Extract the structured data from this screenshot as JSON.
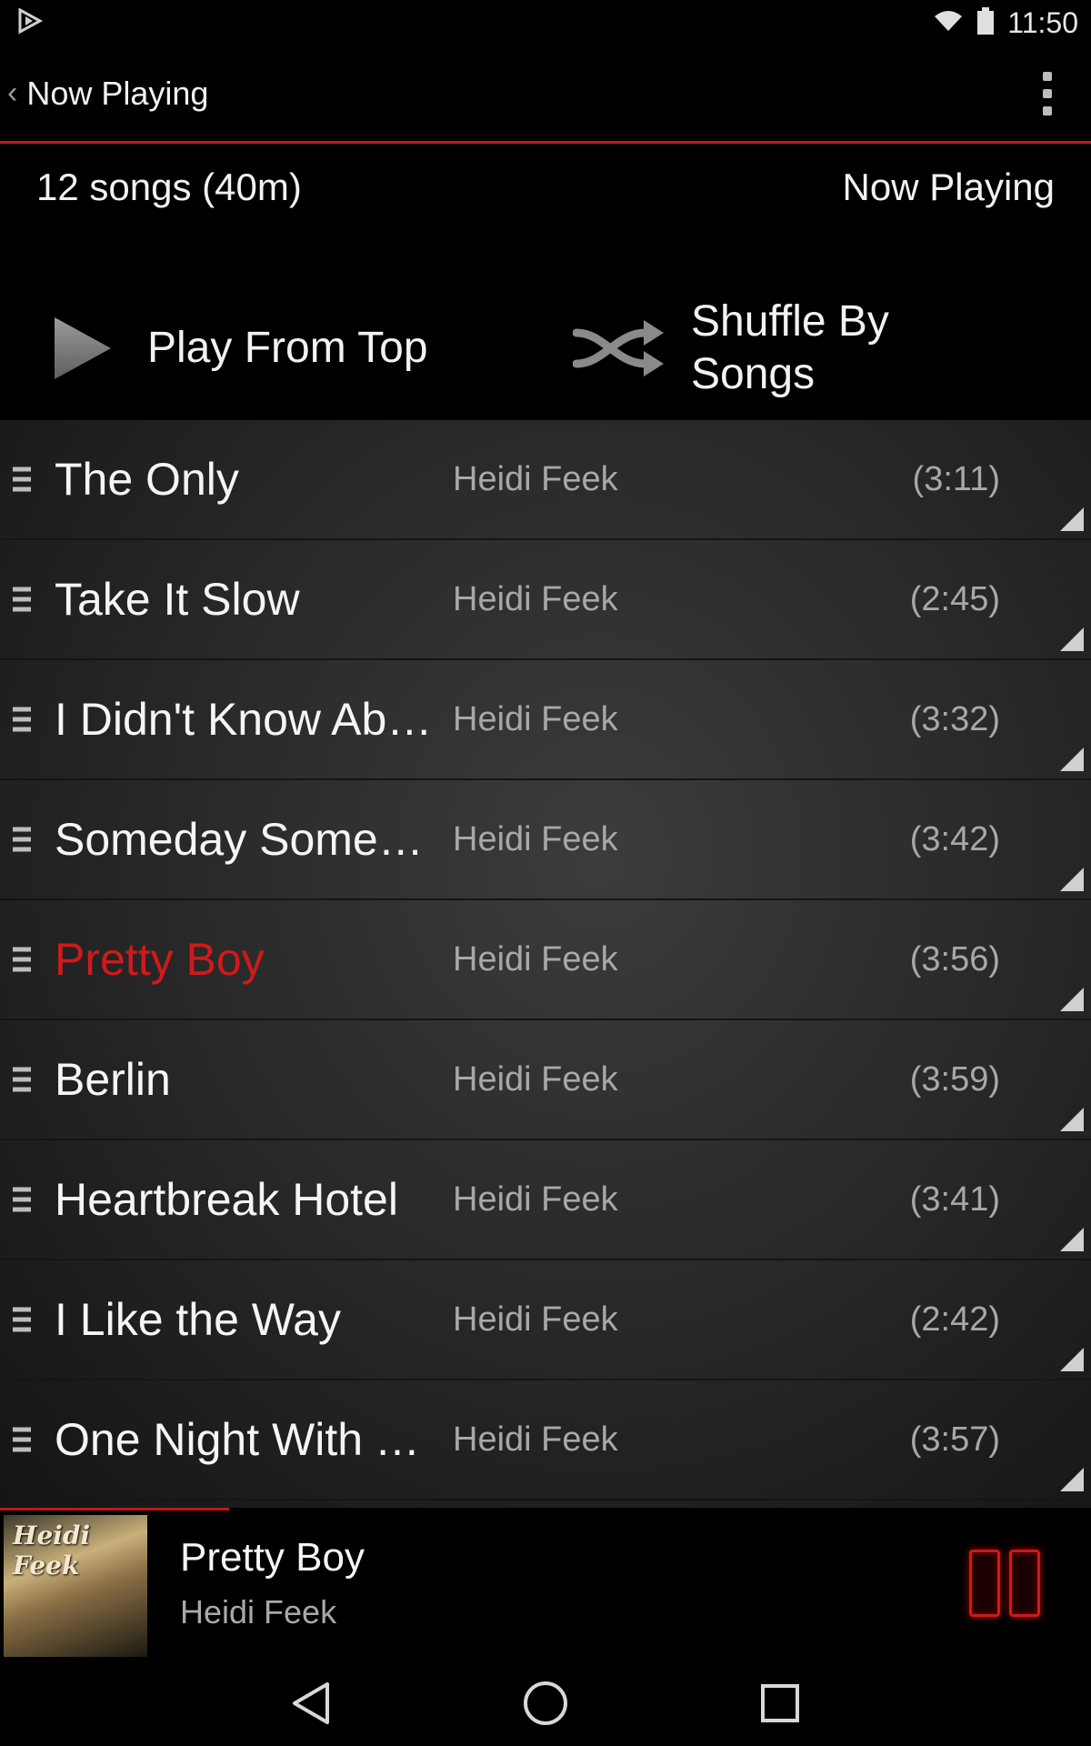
{
  "status_bar": {
    "time": "11:50",
    "icons": [
      "play-store-icon",
      "wifi-icon",
      "battery-icon"
    ]
  },
  "action_bar": {
    "title": "Now Playing",
    "back_icon": "chevron-left-icon",
    "menu_icon": "overflow-menu-icon"
  },
  "info": {
    "song_count": "12 songs (40m)",
    "right_label": "Now Playing"
  },
  "controls": {
    "play_from_top": "Play From Top",
    "shuffle_line1": "Shuffle By",
    "shuffle_line2": "Songs"
  },
  "songs": [
    {
      "title": "The Only",
      "artist": "Heidi Feek",
      "duration": "(3:11)"
    },
    {
      "title": "Take It Slow",
      "artist": "Heidi Feek",
      "duration": "(2:45)"
    },
    {
      "title": "I Didn't Know Abo…",
      "artist": "Heidi Feek",
      "duration": "(3:32)"
    },
    {
      "title": "Someday Someb…",
      "artist": "Heidi Feek",
      "duration": "(3:42)"
    },
    {
      "title": "Pretty Boy",
      "artist": "Heidi Feek",
      "duration": "(3:56)",
      "playing": true
    },
    {
      "title": "Berlin",
      "artist": "Heidi Feek",
      "duration": "(3:59)"
    },
    {
      "title": "Heartbreak Hotel",
      "artist": "Heidi Feek",
      "duration": "(3:41)"
    },
    {
      "title": "I Like the Way",
      "artist": "Heidi Feek",
      "duration": "(2:42)"
    },
    {
      "title": "One Night With You",
      "artist": "Heidi Feek",
      "duration": "(3:57)"
    }
  ],
  "mini_player": {
    "title": "Pretty Boy",
    "artist": "Heidi Feek",
    "album_art_text": "Heidi Feek",
    "progress_fraction": 0.21
  },
  "colors": {
    "accent": "#c01818",
    "playing_text": "#d01a1a"
  },
  "nav_bar": {
    "icons": [
      "back-triangle-icon",
      "home-circle-icon",
      "recents-square-icon"
    ]
  }
}
